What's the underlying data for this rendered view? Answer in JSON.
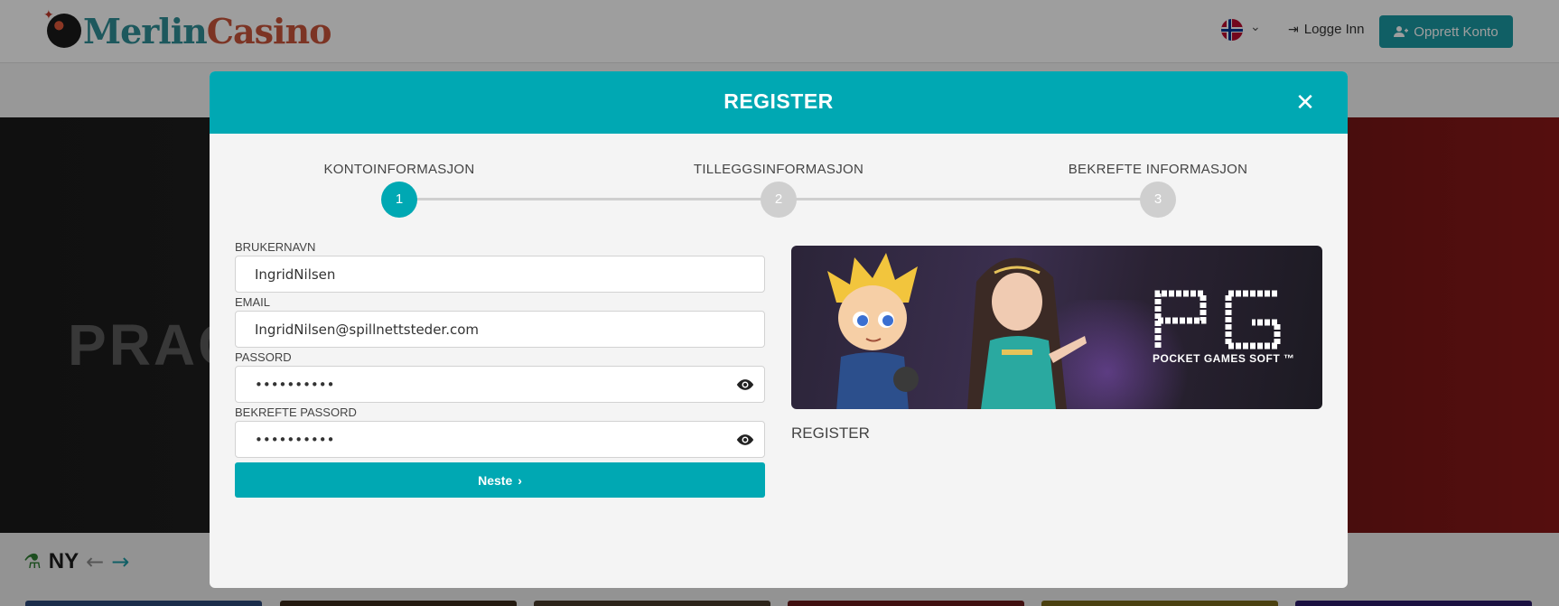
{
  "header": {
    "logo": {
      "part1": "Merlin",
      "part2": "Casino"
    },
    "language": {
      "flag_icon": "norway-flag-icon"
    },
    "login_label": "Logge Inn",
    "signup_label": "Opprett Konto"
  },
  "hero": {
    "text": "PRAG"
  },
  "section": {
    "title": "NY"
  },
  "modal": {
    "title": "REGISTER",
    "steps": [
      {
        "label": "KONTOINFORMASJON",
        "number": "1"
      },
      {
        "label": "TILLEGGSINFORMASJON",
        "number": "2"
      },
      {
        "label": "BEKREFTE INFORMASJON",
        "number": "3"
      }
    ],
    "fields": {
      "username": {
        "label": "BRUKERNAVN",
        "value": "IngridNilsen"
      },
      "email": {
        "label": "EMAIL",
        "value": "IngridNilsen@spillnettsteder.com"
      },
      "password": {
        "label": "PASSORD",
        "value": "••••••••••"
      },
      "confirm": {
        "label": "BEKREFTE PASSORD",
        "value": "••••••••••"
      }
    },
    "next_label": "Neste",
    "banner": {
      "brand": "POCKET GAMES SOFT ™"
    },
    "banner_caption": "REGISTER"
  },
  "colors": {
    "accent": "#00a8b3",
    "header_button": "#1a9aa3",
    "step_inactive": "#cfcfcf"
  }
}
